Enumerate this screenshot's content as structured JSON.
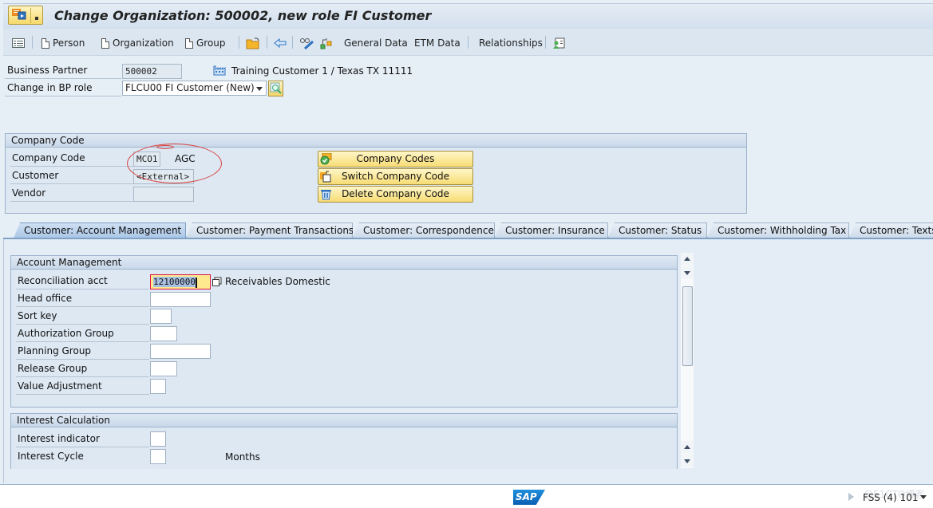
{
  "window": {
    "title": "Change Organization: 500002, new role FI Customer"
  },
  "toolbar": {
    "items": [
      {
        "label": "Person",
        "icon": "document-icon"
      },
      {
        "label": "Organization",
        "icon": "document-icon"
      },
      {
        "label": "Group",
        "icon": "document-icon"
      }
    ],
    "general_data": "General Data",
    "etm_data": "ETM Data",
    "relationships": "Relationships"
  },
  "header": {
    "business_partner_label": "Business Partner",
    "business_partner_value": "500002",
    "partner_description": "Training Customer 1 / Texas TX 11111",
    "bp_role_label": "Change in BP role",
    "bp_role_value": "FLCU00 FI Customer (New)"
  },
  "company_code_group": {
    "title": "Company Code",
    "company_code_label": "Company Code",
    "company_code_value": "MCO1",
    "company_code_name": "AGC",
    "customer_label": "Customer",
    "customer_value": "<External>",
    "vendor_label": "Vendor",
    "vendor_value": "",
    "buttons": {
      "company_codes": "Company Codes",
      "switch_company_code": "Switch Company Code",
      "delete_company_code": "Delete Company Code"
    }
  },
  "tabs": [
    {
      "label": "Customer: Account Management",
      "active": true
    },
    {
      "label": "Customer: Payment Transactions",
      "active": false
    },
    {
      "label": "Customer: Correspondence",
      "active": false
    },
    {
      "label": "Customer: Insurance",
      "active": false
    },
    {
      "label": "Customer: Status",
      "active": false
    },
    {
      "label": "Customer: Withholding Tax",
      "active": false
    },
    {
      "label": "Customer: Texts",
      "active": false
    }
  ],
  "account_management": {
    "title": "Account Management",
    "fields": [
      {
        "label": "Reconciliation acct",
        "value": "12100000",
        "description": "Receivables Domestic"
      },
      {
        "label": "Head office",
        "value": ""
      },
      {
        "label": "Sort key",
        "value": ""
      },
      {
        "label": "Authorization Group",
        "value": ""
      },
      {
        "label": "Planning Group",
        "value": ""
      },
      {
        "label": "Release Group",
        "value": ""
      },
      {
        "label": "Value Adjustment",
        "value": ""
      }
    ]
  },
  "interest_calculation": {
    "title": "Interest Calculation",
    "fields": [
      {
        "label": "Interest indicator",
        "value": ""
      },
      {
        "label": "Interest Cycle",
        "value": "",
        "unit": "Months"
      }
    ]
  },
  "status_bar": {
    "logo": "SAP",
    "system_info": "FSS (4) 101",
    "watermark": "@51CTO博客"
  },
  "colors": {
    "button_yellow": "#f7dc74",
    "annotation_red": "#d9433f",
    "active_tab": "#a9c6e6",
    "background": "#e6eef6"
  }
}
